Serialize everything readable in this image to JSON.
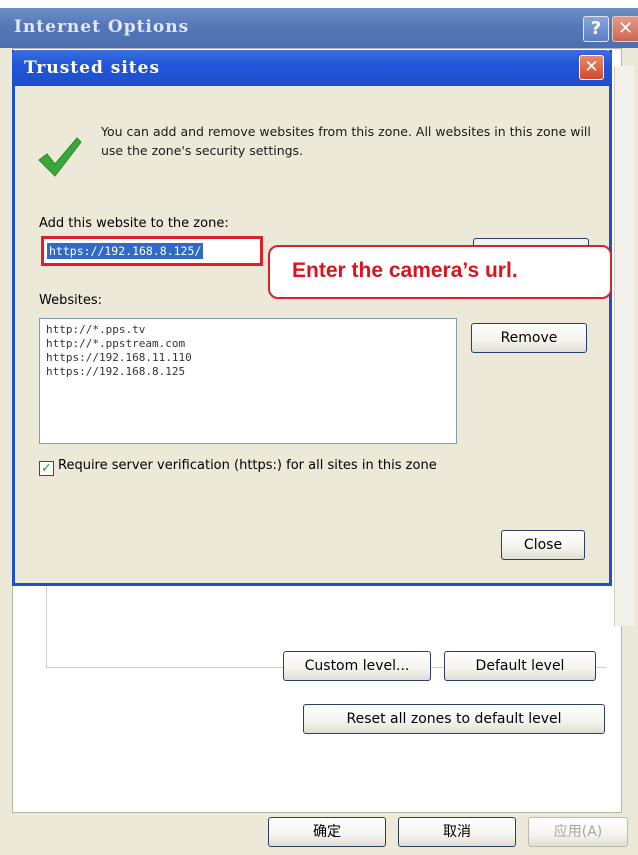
{
  "outer_window": {
    "title": "Internet Options",
    "help_glyph": "?",
    "close_glyph": "✕",
    "buttons": {
      "custom_level": "Custom level...",
      "default_level": "Default level",
      "reset_all": "Reset all zones to default level",
      "ok": "确定",
      "cancel": "取消",
      "apply": "应用(A)"
    }
  },
  "dialog": {
    "title": "Trusted sites",
    "close_glyph": "✕",
    "intro": "You can add and remove websites from this zone. All websites in this zone will use the zone's security settings.",
    "add_label": "Add this website to the zone:",
    "url_value": "https://192.168.8.125/",
    "websites_label": "Websites:",
    "websites": [
      "http://*.pps.tv",
      "http://*.ppstream.com",
      "https://192.168.11.110",
      "https://192.168.8.125"
    ],
    "remove_label": "Remove",
    "require_label": "Require server verification (https:) for all sites in this zone",
    "require_checked": true,
    "close_label": "Close"
  },
  "callout": {
    "text": "Enter the camera’s url.",
    "color": "#d9141e"
  },
  "colors": {
    "dialog_title": "#2156d8",
    "annotation_red": "#d6232b"
  }
}
